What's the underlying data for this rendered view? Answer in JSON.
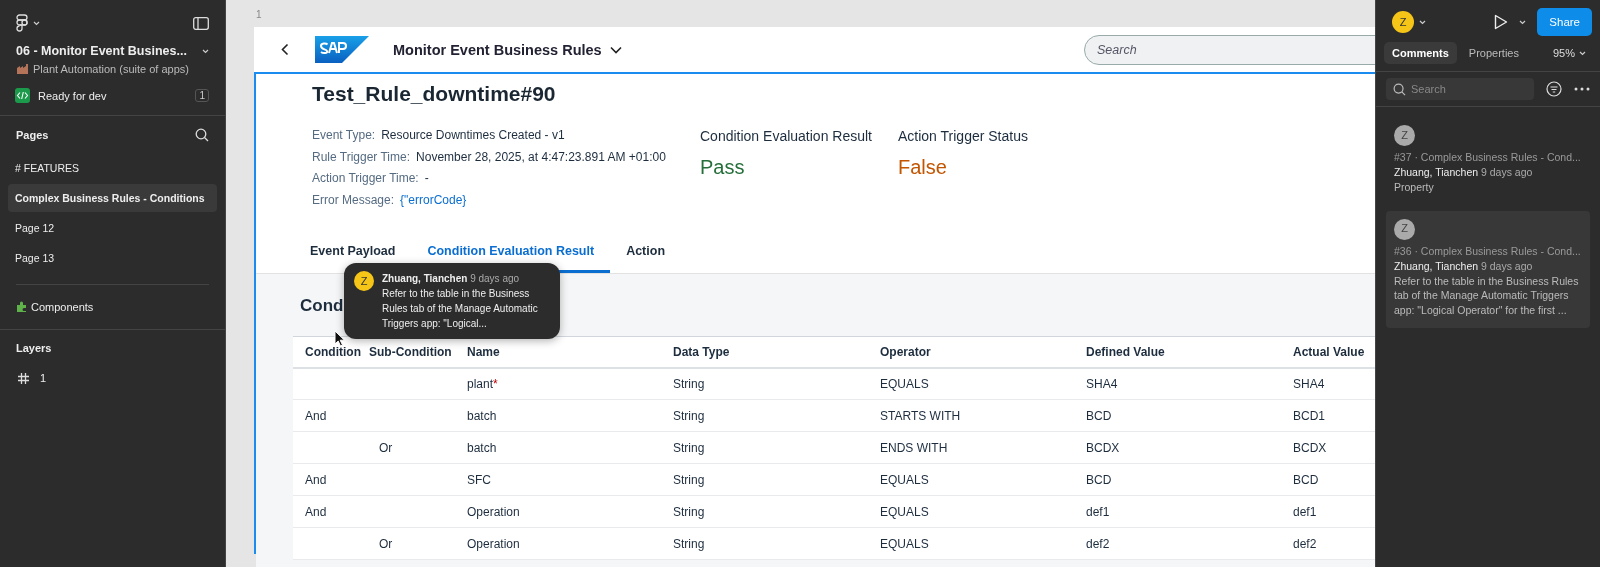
{
  "sidebar": {
    "file_title": "06 - Monitor Event Busines...",
    "project": "Plant Automation (suite of apps)",
    "status": {
      "label": "Ready for dev",
      "count": "1"
    },
    "pages_heading": "Pages",
    "pages": [
      {
        "label": "# FEATURES",
        "selected": false
      },
      {
        "label": "Complex Business Rules - Conditions",
        "selected": true
      },
      {
        "label": "Page 12",
        "selected": false
      },
      {
        "label": "Page 13",
        "selected": false
      }
    ],
    "library_item": "Components",
    "layers_heading": "Layers",
    "layers": [
      {
        "label": "1"
      }
    ]
  },
  "canvas": {
    "frame_label": "1",
    "app": {
      "title": "Monitor Event Business Rules",
      "search": {
        "placeholder": "Search"
      },
      "rule_title": "Test_Rule_downtime#90",
      "fields": [
        {
          "label": "Event Type:",
          "value": "Resource Downtimes Created - v1",
          "kind": "text"
        },
        {
          "label": "Rule Trigger Time:",
          "value": "November 28, 2025, at 4:47:23.891 AM +01:00",
          "kind": "text"
        },
        {
          "label": "Action Trigger Time:",
          "value": "-",
          "kind": "text"
        },
        {
          "label": "Error Message:",
          "value": "{\"errorCode}",
          "kind": "link"
        }
      ],
      "results": [
        {
          "label": "Condition Evaluation Result",
          "value": "Pass",
          "kind": "positive"
        },
        {
          "label": "Action Trigger Status",
          "value": "False",
          "kind": "negative"
        }
      ],
      "tabs": [
        {
          "label": "Event Payload",
          "selected": false
        },
        {
          "label": "Condition Evaluation Result",
          "selected": true
        },
        {
          "label": "Action",
          "selected": false
        }
      ],
      "section_title": "Cond",
      "table": {
        "columns": [
          "Condition",
          "Sub-Condition",
          "Name",
          "Data Type",
          "Operator",
          "Defined Value",
          "Actual Value"
        ],
        "rows": [
          {
            "condition": "",
            "sub_condition": "",
            "name": "plant",
            "mark": "*",
            "data_type": "String",
            "operator": "EQUALS",
            "defined_value": "SHA4",
            "actual_value": "SHA4"
          },
          {
            "condition": "And",
            "sub_condition": "",
            "name": "batch",
            "data_type": "String",
            "operator": "STARTS WITH",
            "defined_value": "BCD",
            "actual_value": "BCD1"
          },
          {
            "condition": "",
            "sub_condition": "Or",
            "name": "batch",
            "data_type": "String",
            "operator": "ENDS WITH",
            "defined_value": "BCDX",
            "actual_value": "BCDX"
          },
          {
            "condition": "And",
            "sub_condition": "",
            "name": "SFC",
            "data_type": "String",
            "operator": "EQUALS",
            "defined_value": "BCD",
            "actual_value": "BCD"
          },
          {
            "condition": "And",
            "sub_condition": "",
            "name": "Operation",
            "data_type": "String",
            "operator": "EQUALS",
            "defined_value": "def1",
            "actual_value": "def1"
          },
          {
            "condition": "",
            "sub_condition": "Or",
            "name": "Operation",
            "data_type": "String",
            "operator": "EQUALS",
            "defined_value": "def2",
            "actual_value": "def2"
          }
        ]
      }
    },
    "tooltip": {
      "avatar": "Z",
      "author": "Zhuang, Tianchen",
      "time": "9 days ago",
      "text": "Refer to the table in the Business Rules tab of the Manage Automatic Triggers app: \"Logical..."
    }
  },
  "panel": {
    "avatar": "Z",
    "share": "Share",
    "tabs": [
      {
        "label": "Comments",
        "selected": true
      },
      {
        "label": "Properties",
        "selected": false
      }
    ],
    "zoom": "95%",
    "search": {
      "placeholder": "Search"
    },
    "comments": [
      {
        "avatar": "Z",
        "context": "#37 · Complex Business Rules - Cond...",
        "author": "Zhuang, Tianchen",
        "time": "9 days ago",
        "text": "Property",
        "selected": false
      },
      {
        "avatar": "Z",
        "context": "#36 · Complex Business Rules - Cond...",
        "author": "Zhuang, Tianchen",
        "time": "9 days ago",
        "text": "Refer to the table in the Business Rules tab of the Manage Automatic Triggers app: \"Logical Operator\" for the first ...",
        "selected": true
      }
    ]
  }
}
